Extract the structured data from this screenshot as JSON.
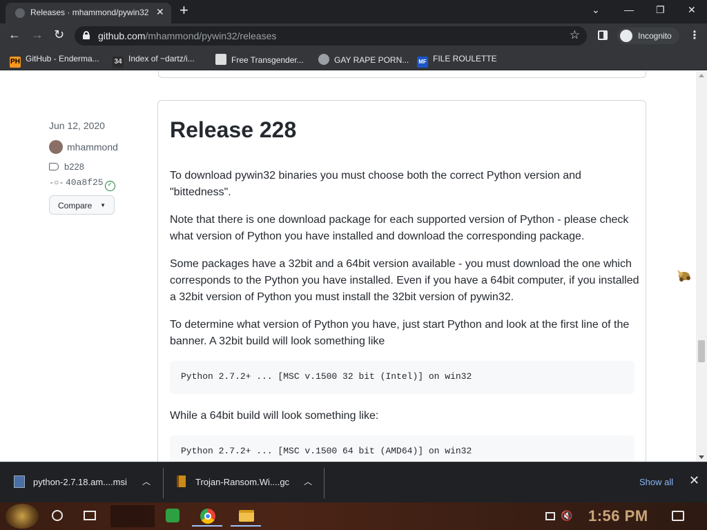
{
  "browser": {
    "tab_title": "Releases · mhammond/pywin32",
    "url_host": "github.com",
    "url_path": "/mhammond/pywin32/releases",
    "incognito_label": "Incognito"
  },
  "bookmarks": [
    {
      "label": "GitHub - Enderma...",
      "icon_text": "PH",
      "icon_color": "#f7971e"
    },
    {
      "label": "Index of ~dartz/i...",
      "icon_text": "34",
      "icon_color": "#2b2b2b"
    },
    {
      "label": "Free Transgender...",
      "icon_text": "",
      "icon_color": "#dddddd"
    },
    {
      "label": "GAY RAPE PORN...",
      "icon_text": "",
      "icon_color": "#9aa0a6"
    },
    {
      "label": "FILE ROULETTE",
      "icon_text": "MF",
      "icon_color": "#1a56c9"
    }
  ],
  "release": {
    "date": "Jun 12, 2020",
    "author": "mhammond",
    "tag": "b228",
    "commit": "40a8f25",
    "compare_label": "Compare",
    "title": "Release 228",
    "paragraphs": [
      "To download pywin32 binaries you must choose both the correct Python version and \"bittedness\".",
      "Note that there is one download package for each supported version of Python - please check what version of Python you have installed and download the corresponding package.",
      "Some packages have a 32bit and a 64bit version available - you must download the one which corresponds to the Python you have installed. Even if you have a 64bit computer, if you installed a 32bit version of Python you must install the 32bit version of pywin32.",
      "To determine what version of Python you have, just start Python and look at the first line of the banner. A 32bit build will look something like"
    ],
    "code_32": "Python 2.7.2+ ... [MSC v.1500 32 bit (Intel)] on win32",
    "para_64": "While a 64bit build will look something like:",
    "code_64": "Python 2.7.2+ ... [MSC v.1500 64 bit (AMD64)] on win32"
  },
  "downloads": {
    "items": [
      {
        "name": "python-2.7.18.am....msi"
      },
      {
        "name": "Trojan-Ransom.Wi....gc"
      }
    ],
    "show_all": "Show all"
  },
  "taskbar": {
    "clock": "1:56 PM"
  },
  "colors": {
    "link": "#8ab4f8",
    "text": "#24292f",
    "muted": "#57606a",
    "verified": "#1a7f37",
    "clock": "#c9a57a"
  }
}
